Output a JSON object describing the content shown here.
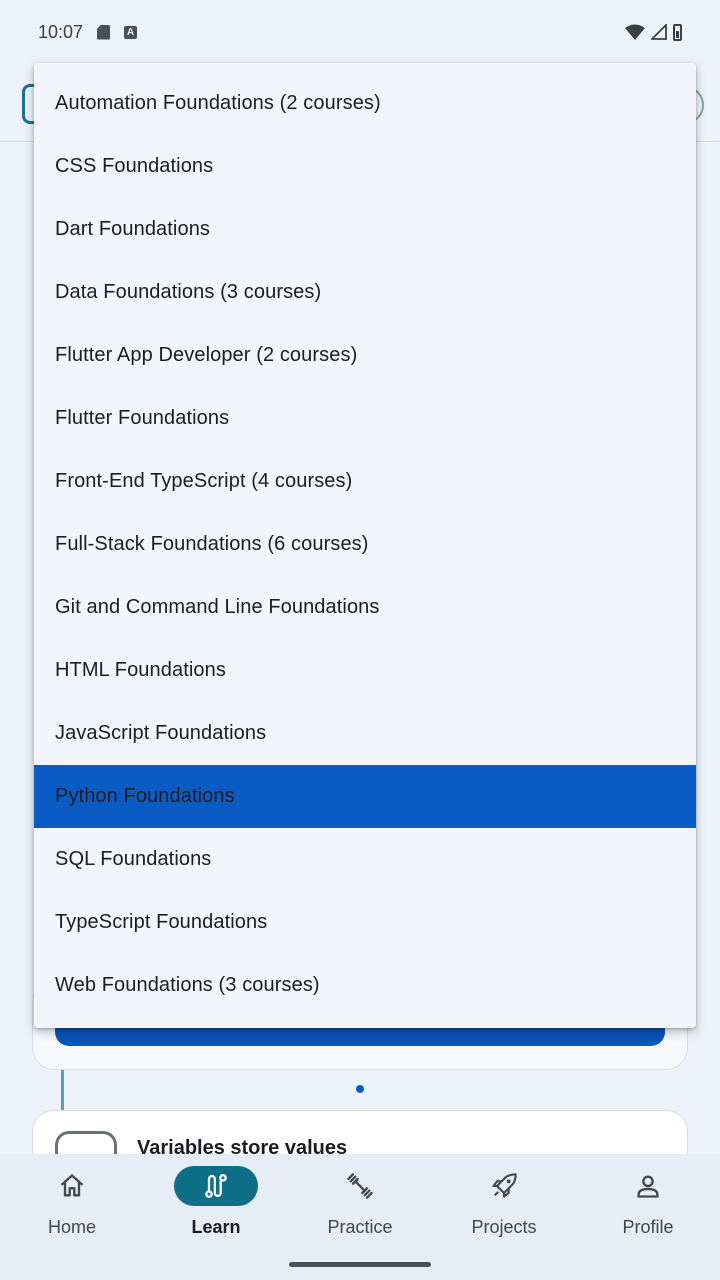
{
  "status_bar": {
    "time": "10:07",
    "a_badge": "A"
  },
  "dropdown": {
    "items": [
      {
        "label": "Automation Foundations (2 courses)",
        "selected": false
      },
      {
        "label": "CSS Foundations",
        "selected": false
      },
      {
        "label": "Dart Foundations",
        "selected": false
      },
      {
        "label": "Data Foundations (3 courses)",
        "selected": false
      },
      {
        "label": "Flutter App Developer (2 courses)",
        "selected": false
      },
      {
        "label": "Flutter Foundations",
        "selected": false
      },
      {
        "label": "Front-End TypeScript (4 courses)",
        "selected": false
      },
      {
        "label": "Full-Stack Foundations (6 courses)",
        "selected": false
      },
      {
        "label": "Git and Command Line Foundations",
        "selected": false
      },
      {
        "label": "HTML Foundations",
        "selected": false
      },
      {
        "label": "JavaScript Foundations",
        "selected": false
      },
      {
        "label": "Python Foundations",
        "selected": true
      },
      {
        "label": "SQL Foundations",
        "selected": false
      },
      {
        "label": "TypeScript Foundations",
        "selected": false
      },
      {
        "label": "Web Foundations (3 courses)",
        "selected": false
      }
    ]
  },
  "lesson_card": {
    "title": "Variables store values"
  },
  "bottom_nav": {
    "items": [
      {
        "label": "Home",
        "icon": "home-icon",
        "active": false
      },
      {
        "label": "Learn",
        "icon": "route-icon",
        "active": true
      },
      {
        "label": "Practice",
        "icon": "dumbbell-icon",
        "active": false
      },
      {
        "label": "Projects",
        "icon": "rocket-icon",
        "active": false
      },
      {
        "label": "Profile",
        "icon": "person-icon",
        "active": false
      }
    ]
  },
  "colors": {
    "accent": "#0a5cc4",
    "nav_active": "#0e6f86",
    "background": "#edf2fa"
  }
}
